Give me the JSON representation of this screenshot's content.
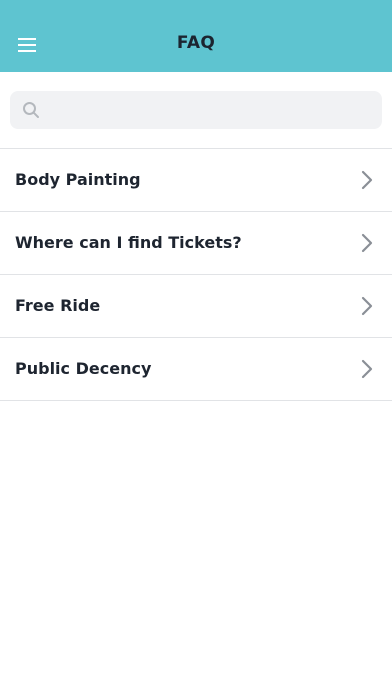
{
  "header": {
    "title": "FAQ",
    "menu_icon": "hamburger-menu-icon",
    "background_color": "#5ec4d0"
  },
  "search": {
    "placeholder": "",
    "value": "",
    "icon": "search-icon"
  },
  "faq_items": [
    {
      "label": "Body Painting",
      "icon": "chevron-right-icon"
    },
    {
      "label": "Where can I find Tickets?",
      "icon": "chevron-right-icon"
    },
    {
      "label": "Free Ride",
      "icon": "chevron-right-icon"
    },
    {
      "label": "Public Decency",
      "icon": "chevron-right-icon"
    }
  ]
}
